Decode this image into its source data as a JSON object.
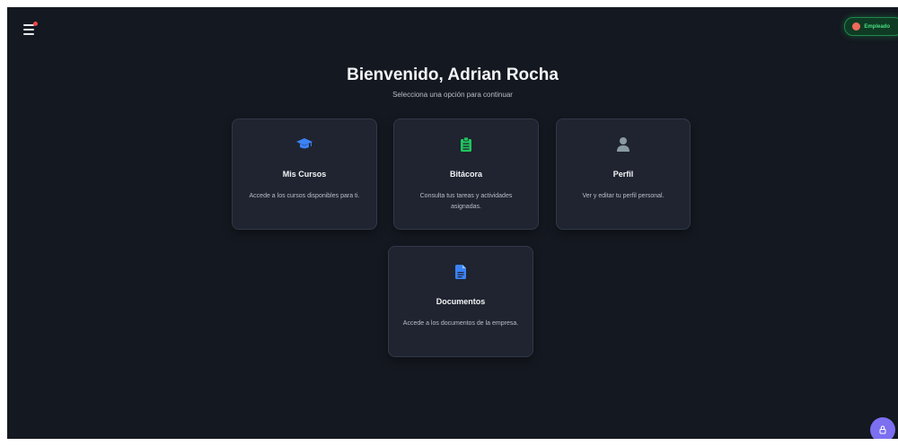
{
  "header": {
    "menu_icon": "hamburger-menu-icon",
    "notification_dot_color": "#ef4444",
    "role_badge": {
      "label": "Empleado",
      "icon": "flag-icon"
    }
  },
  "welcome": {
    "title": "Bienvenido, Adrian Rocha",
    "subtitle": "Selecciona una opción para continuar"
  },
  "cards": [
    {
      "title": "Mis Cursos",
      "description": "Accede a los cursos disponibles para ti.",
      "icon": "graduation-cap-icon",
      "color": "#3b82f6"
    },
    {
      "title": "Bitácora",
      "description": "Consulta tus tareas y actividades asignadas.",
      "icon": "clipboard-list-icon",
      "color": "#22c55e"
    },
    {
      "title": "Perfil",
      "description": "Ver y editar tu perfil personal.",
      "icon": "user-icon",
      "color": "#8a9aa3"
    },
    {
      "title": "Documentos",
      "description": "Accede a los documentos de la empresa.",
      "icon": "document-icon",
      "color": "#3b82f6"
    }
  ],
  "assistant_button": {
    "icon": "accessibility-icon",
    "color": "#7c6ff0"
  }
}
